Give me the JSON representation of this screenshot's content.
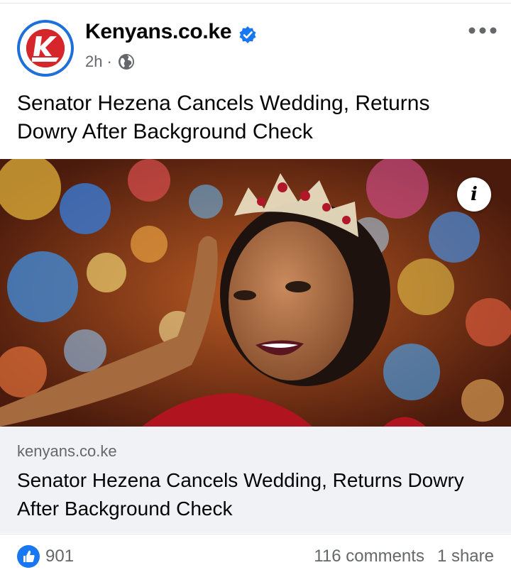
{
  "post": {
    "page_name": "Kenyans.co.ke",
    "time": "2h",
    "separator": "·",
    "text": "Senator Hezena Cancels Wedding, Returns Dowry After Background Check"
  },
  "link_preview": {
    "domain": "kenyans.co.ke",
    "title": "Senator Hezena Cancels Wedding, Returns Dowry After Background Check"
  },
  "photo": {
    "info_label": "i"
  },
  "footer": {
    "like_count": "901",
    "comments": "116 comments",
    "shares": "1 share"
  },
  "colors": {
    "brand_blue": "#1877f2",
    "logo_red": "#d6262b",
    "secondary_text": "#65676b"
  },
  "icons": [
    "kenyans-logo-icon",
    "verified-badge-icon",
    "globe-icon",
    "more-options-icon",
    "info-icon",
    "like-icon"
  ]
}
